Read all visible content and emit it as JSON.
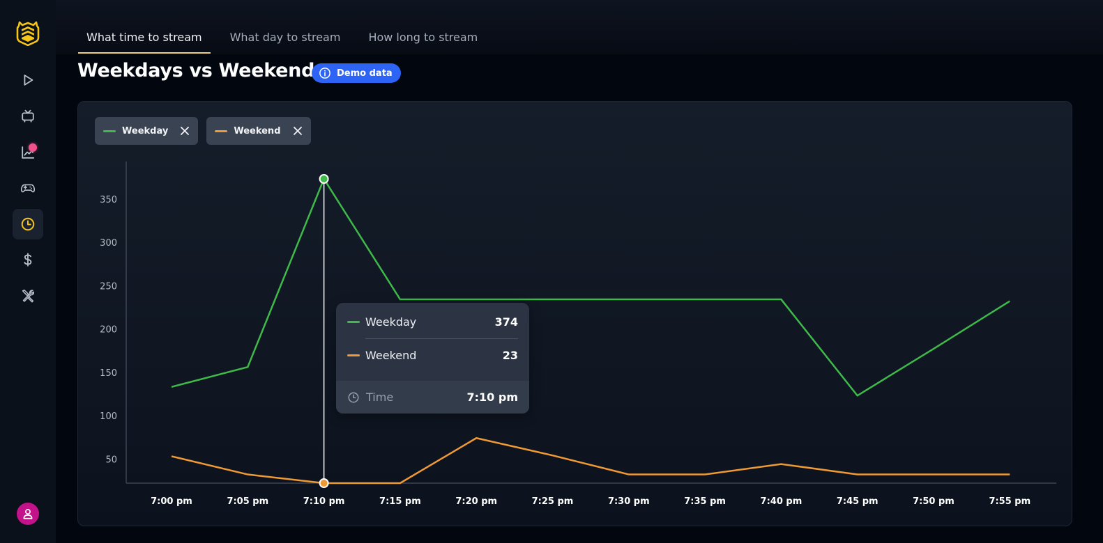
{
  "sidebar": {
    "logo": "hive-shield-logo",
    "items": [
      {
        "name": "play-icon",
        "active": false
      },
      {
        "name": "tv-icon",
        "active": false
      },
      {
        "name": "trending-chart-icon",
        "active": false,
        "notification": true
      },
      {
        "name": "gamepad-icon",
        "active": false
      },
      {
        "name": "clock-icon",
        "active": true
      },
      {
        "name": "dollar-icon",
        "active": false
      },
      {
        "name": "tools-icon",
        "active": false
      }
    ],
    "avatar": "user-icon"
  },
  "tabs": [
    {
      "label": "What time to stream",
      "active": true
    },
    {
      "label": "What day to stream",
      "active": false
    },
    {
      "label": "How long to stream",
      "active": false
    }
  ],
  "page": {
    "title": "Weekdays vs Weekends",
    "badge": "Demo data"
  },
  "colors": {
    "weekday": "#3fba4a",
    "weekend": "#f09a35",
    "accent_tab": "#f0cf7a",
    "badge": "#2e64f5",
    "logo": "#f5c518"
  },
  "legend": [
    {
      "label": "Weekday",
      "color": "#3fba4a"
    },
    {
      "label": "Weekend",
      "color": "#f09a35"
    }
  ],
  "tooltip": {
    "rows": [
      {
        "label": "Weekday",
        "value": "374"
      },
      {
        "label": "Weekend",
        "value": "23"
      }
    ],
    "footer_label": "Time",
    "footer_value": "7:10 pm"
  },
  "chart_data": {
    "type": "line",
    "title": "Weekdays vs Weekends",
    "xlabel": "",
    "ylabel": "",
    "categories": [
      "7:00 pm",
      "7:05 pm",
      "7:10 pm",
      "7:15 pm",
      "7:20 pm",
      "7:25 pm",
      "7:30 pm",
      "7:35 pm",
      "7:40 pm",
      "7:45 pm",
      "7:50 pm",
      "7:55 pm"
    ],
    "series": [
      {
        "name": "Weekday",
        "values": [
          134,
          157,
          374,
          235,
          235,
          235,
          235,
          235,
          235,
          124,
          178,
          233
        ]
      },
      {
        "name": "Weekend",
        "values": [
          54,
          33,
          23,
          23,
          75,
          55,
          33,
          33,
          45,
          33,
          33,
          33
        ]
      }
    ],
    "yticks": [
      50,
      100,
      150,
      200,
      250,
      300,
      350
    ],
    "ylim": [
      23,
      400
    ],
    "grid": false,
    "legend": "top-left",
    "highlight_index": 2
  }
}
